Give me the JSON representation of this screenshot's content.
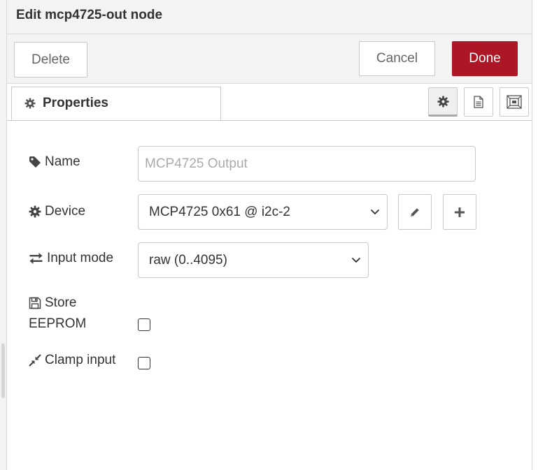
{
  "dialog": {
    "title": "Edit mcp4725-out node"
  },
  "tray": {
    "delete_label": "Delete",
    "cancel_label": "Cancel",
    "done_label": "Done",
    "done_color": "#ad1625"
  },
  "tabs": {
    "properties_label": "Properties",
    "buttons": [
      {
        "icon": "gear-icon",
        "active": true
      },
      {
        "icon": "file-text-icon",
        "active": false
      },
      {
        "icon": "frame-icon",
        "active": false
      }
    ]
  },
  "form": {
    "name": {
      "label": "Name",
      "icon": "tag-icon",
      "value": "",
      "placeholder": "MCP4725 Output"
    },
    "device": {
      "label": "Device",
      "icon": "gear-icon",
      "selected": "MCP4725 0x61 @ i2c-2",
      "edit_icon": "pencil-icon",
      "add_icon": "plus-icon"
    },
    "input_mode": {
      "label": "Input mode",
      "icon": "exchange-icon",
      "selected": "raw (0..4095)"
    },
    "store_eeprom": {
      "label_line1": "Store",
      "label_line2": "EEPROM",
      "icon": "floppy-disk-icon",
      "checked": false
    },
    "clamp_input": {
      "label": "Clamp input",
      "icon": "compress-icon",
      "checked": false
    }
  }
}
